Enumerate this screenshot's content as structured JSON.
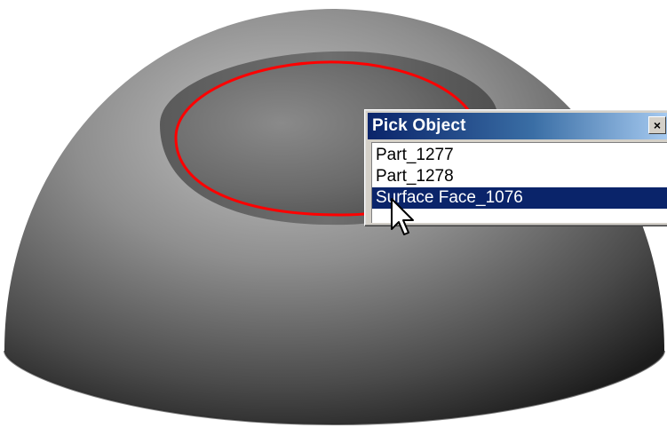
{
  "dialog": {
    "title": "Pick Object",
    "close_glyph": "×",
    "items": [
      {
        "label": "Part_1277",
        "selected": false
      },
      {
        "label": "Part_1278",
        "selected": false
      },
      {
        "label": "Surface Face_1076",
        "selected": true
      }
    ]
  },
  "scene": {
    "object": "hemisphere-with-recessed-face",
    "highlight_color": "#ff0000"
  },
  "icons": {
    "pointer": "arrow-cursor-icon"
  }
}
